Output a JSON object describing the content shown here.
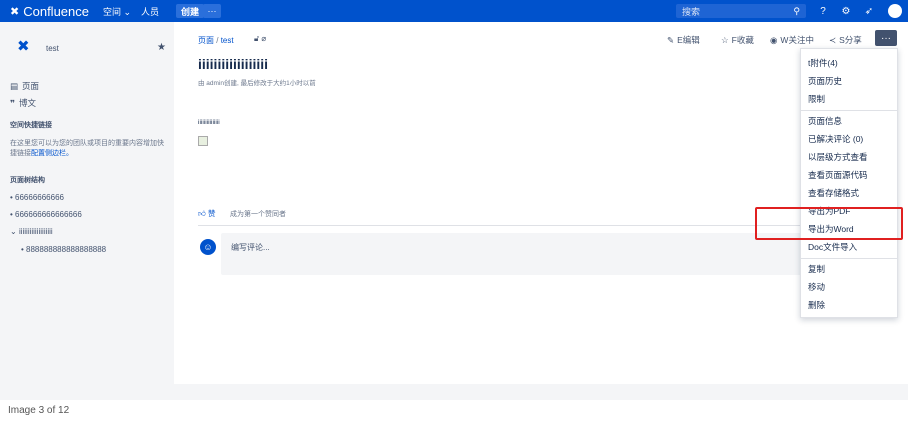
{
  "topbar": {
    "app_name": "Confluence",
    "spaces_label": "空间 ⌄",
    "people_label": "人员",
    "create_label": "创建",
    "more_label": "···",
    "search_placeholder": "搜索",
    "colors": {
      "bar": "#0052cc"
    }
  },
  "sidebar": {
    "space_name": "test",
    "links": [
      {
        "icon": "page-icon",
        "label": "页面"
      },
      {
        "icon": "quote-icon",
        "label": "博文"
      }
    ],
    "shortcuts_heading": "空间快捷链接",
    "shortcuts_desc": "在这里您可以为您的团队或项目的重要内容增加快捷链接",
    "shortcuts_link": "配置侧边栏。",
    "tree_heading": "页面树结构",
    "tree": [
      "66666666666",
      "666666666666666",
      "iiiiiiiiiiiiiiiiiii",
      "888888888888888888"
    ]
  },
  "main": {
    "breadcrumb": {
      "first": "页面",
      "sep": "/",
      "second": "test"
    },
    "title": "iiiiiiiiiiiiiiiiii",
    "byline": "由 admin创建, 最后修改于大约1小时以前",
    "content_text": "iiiiiiiiiiiiiii",
    "actions": {
      "edit": "E编辑",
      "favorite": "F收藏",
      "watching": "W关注中",
      "share": "S分享"
    },
    "like_label": "赞",
    "like_desc": "成为第一个赞同者",
    "comment_placeholder": "编写评论..."
  },
  "menu": {
    "items": [
      "t附件(4)",
      "页面历史",
      "限制",
      "页面信息",
      "已解决评论 (0)",
      "以层级方式查看",
      "查看页面源代码",
      "查看存储格式",
      "导出为PDF",
      "导出为Word",
      "Doc文件导入",
      "复制",
      "移动",
      "删除"
    ],
    "highlight_color": "#e02020"
  },
  "caption": "Image 3 of 12"
}
